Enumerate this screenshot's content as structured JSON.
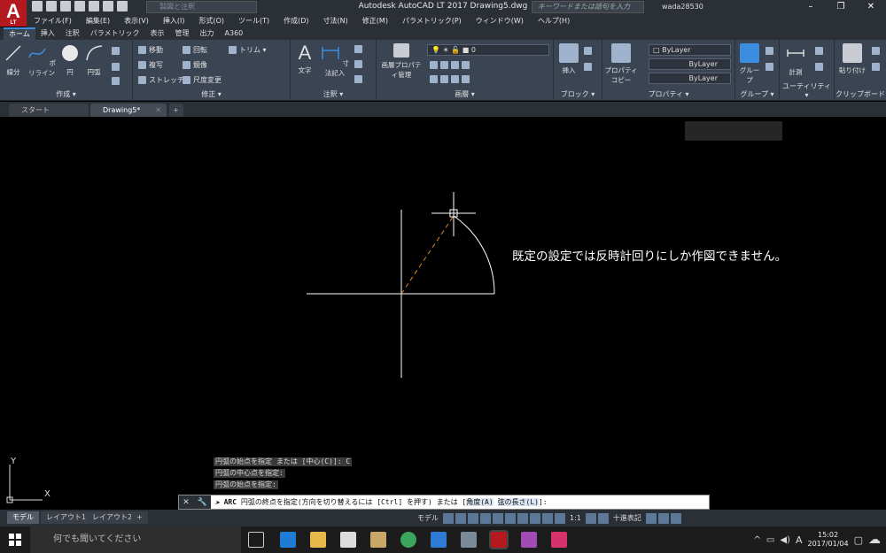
{
  "app": {
    "logo_letter": "A",
    "logo_sub": "LT",
    "title": "Autodesk AutoCAD LT 2017    Drawing5.dwg",
    "workspace_placeholder": "製図と注釈",
    "search_placeholder": "キーワードまたは語句を入力",
    "user": "wada28530"
  },
  "menu": [
    "ファイル(F)",
    "編集(E)",
    "表示(V)",
    "挿入(I)",
    "形式(O)",
    "ツール(T)",
    "作成(D)",
    "寸法(N)",
    "修正(M)",
    "パラメトリック(P)",
    "ウィンドウ(W)",
    "ヘルプ(H)"
  ],
  "ribbon_tabs": [
    "ホーム",
    "挿入",
    "注釈",
    "パラメトリック",
    "表示",
    "管理",
    "出力",
    "A360"
  ],
  "ribbon": {
    "draw": {
      "title": "作成 ▾",
      "line": "線分",
      "polyline": "ポリライン",
      "circle": "円",
      "arc": "円弧"
    },
    "modify": {
      "title": "修正 ▾",
      "move": "移動",
      "rotate": "回転",
      "trim": "トリム ▾",
      "copy": "複写",
      "mirror": "鏡像",
      "stretch": "ストレッチ",
      "scale": "尺度変更"
    },
    "annotation": {
      "title": "注釈 ▾",
      "text": "文字",
      "dimension": "寸法記入"
    },
    "layers": {
      "title": "画層 ▾",
      "props": "画層プロパティ管理",
      "current": "0"
    },
    "block": {
      "title": "ブロック ▾",
      "insert": "挿入"
    },
    "properties": {
      "title": "プロパティ ▾",
      "match": "プロパティコピー",
      "color": "ByLayer",
      "linetype": "ByLayer",
      "lineweight": "ByLayer"
    },
    "group": {
      "title": "グループ ▾",
      "group": "グループ"
    },
    "utilities": {
      "title": "ユーティリティ ▾",
      "measure": "計測"
    },
    "clipboard": {
      "title": "クリップボード",
      "paste": "貼り付け"
    }
  },
  "doc_tabs": {
    "start": "スタート",
    "drawing": "Drawing5*"
  },
  "canvas": {
    "annotation": "既定の設定では反時計回りにしか作図できません。",
    "ucs_y": "Y",
    "ucs_x": "X"
  },
  "command": {
    "history": [
      "円弧の始点を指定 または [中心(C)]: C",
      "円弧の中心点を指定:",
      "円弧の始点を指定:"
    ],
    "cmd_name": "ARC",
    "prompt": "円弧の終点を指定(方向を切り替えるには [Ctrl] を押す) または [",
    "opt1": "角度(A)",
    "opt2": "弦の長さ(L)",
    "prompt_end": "]:"
  },
  "layout_tabs": [
    "モデル",
    "レイアウト1",
    "レイアウト2"
  ],
  "status": {
    "model": "モデル",
    "scale": "1:1",
    "units": "十進表記"
  },
  "taskbar": {
    "search": "何でも聞いてください",
    "time": "15:02",
    "date": "2017/01/04",
    "ime": "A"
  }
}
